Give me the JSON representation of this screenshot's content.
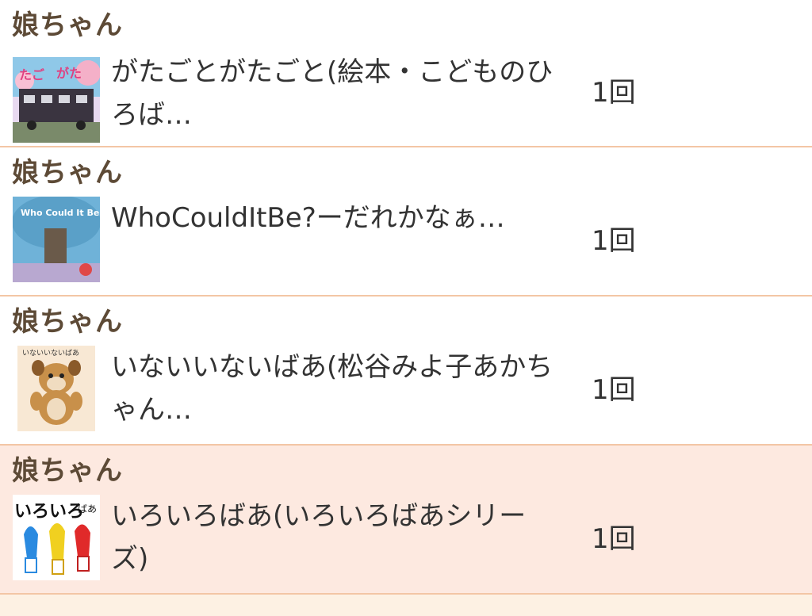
{
  "items": [
    {
      "user": "娘ちゃん",
      "title": "がたごとがたごと(絵本・こどものひろば…",
      "count": "1回",
      "thumb_icon": "book-cover-train"
    },
    {
      "user": "娘ちゃん",
      "title": "WhoCouldItBe?ーだれかなぁ…",
      "count": "1回",
      "thumb_icon": "book-cover-tree"
    },
    {
      "user": "娘ちゃん",
      "title": "いないいないばあ(松谷みよ子あかちゃん…",
      "count": "1回",
      "thumb_icon": "book-cover-bear"
    },
    {
      "user": "娘ちゃん",
      "title": "いろいろばあ(いろいろばあシリーズ)",
      "count": "1回",
      "thumb_icon": "book-cover-colors"
    }
  ],
  "colors": {
    "user_name": "#5d4a36",
    "divider": "#f3c6a5",
    "highlight_row": "#fde9e0"
  }
}
